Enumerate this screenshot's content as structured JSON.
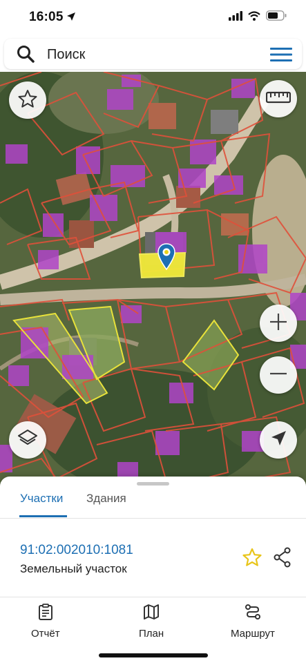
{
  "status": {
    "time": "16:05"
  },
  "search": {
    "placeholder": "Поиск"
  },
  "map": {
    "selected_parcel_color": "#f2ea3a",
    "pin_color": "#1d6fb3",
    "building_color": "#b044c8",
    "boundary_color": "#e0503a"
  },
  "sheet": {
    "tabs": [
      {
        "label": "Участки",
        "active": true
      },
      {
        "label": "Здания",
        "active": false
      }
    ],
    "parcel": {
      "number": "91:02:002010:1081",
      "type": "Земельный участок",
      "favorite_color": "#e8c51a"
    }
  },
  "bottom_nav": [
    {
      "label": "Отчёт",
      "icon": "report-icon"
    },
    {
      "label": "План",
      "icon": "map-plan-icon"
    },
    {
      "label": "Маршрут",
      "icon": "route-icon"
    }
  ]
}
